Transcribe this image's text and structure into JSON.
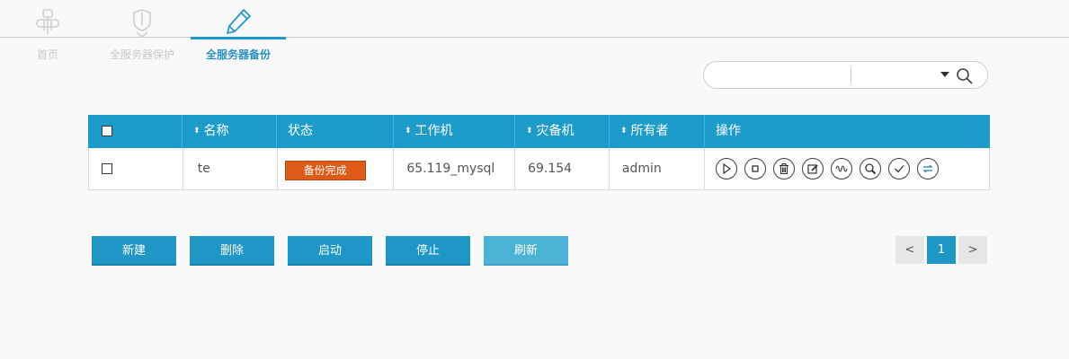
{
  "nav": {
    "items": [
      {
        "label": "首页",
        "icon": "home-icon"
      },
      {
        "label": "全服务器保护",
        "icon": "shield-icon"
      },
      {
        "label": "全服务器备份",
        "icon": "pencil-icon",
        "active": true
      }
    ]
  },
  "search": {
    "value": "",
    "placeholder": ""
  },
  "table": {
    "columns": [
      {
        "label": "",
        "sortable": false
      },
      {
        "label": "名称",
        "sortable": true
      },
      {
        "label": "状态",
        "sortable": false
      },
      {
        "label": "工作机",
        "sortable": true
      },
      {
        "label": "灾备机",
        "sortable": true
      },
      {
        "label": "所有者",
        "sortable": true
      },
      {
        "label": "操作",
        "sortable": false
      }
    ],
    "rows": [
      {
        "name": "te",
        "status": "备份完成",
        "work_machine": "65.119_mysql",
        "dr_machine": "69.154",
        "owner": "admin"
      }
    ],
    "actions": [
      "play-icon",
      "stop-icon",
      "trash-icon",
      "edit-icon",
      "wave-icon",
      "search-icon",
      "check-icon",
      "swap-icon"
    ]
  },
  "buttons": {
    "new": "新建",
    "delete": "删除",
    "start": "启动",
    "stop": "停止",
    "refresh": "刷新"
  },
  "pagination": {
    "prev": "<",
    "current": "1",
    "next": ">"
  },
  "colors": {
    "primary": "#1d9ccb",
    "status_done": "#e05a17",
    "active_nav": "#2a8fc0"
  }
}
